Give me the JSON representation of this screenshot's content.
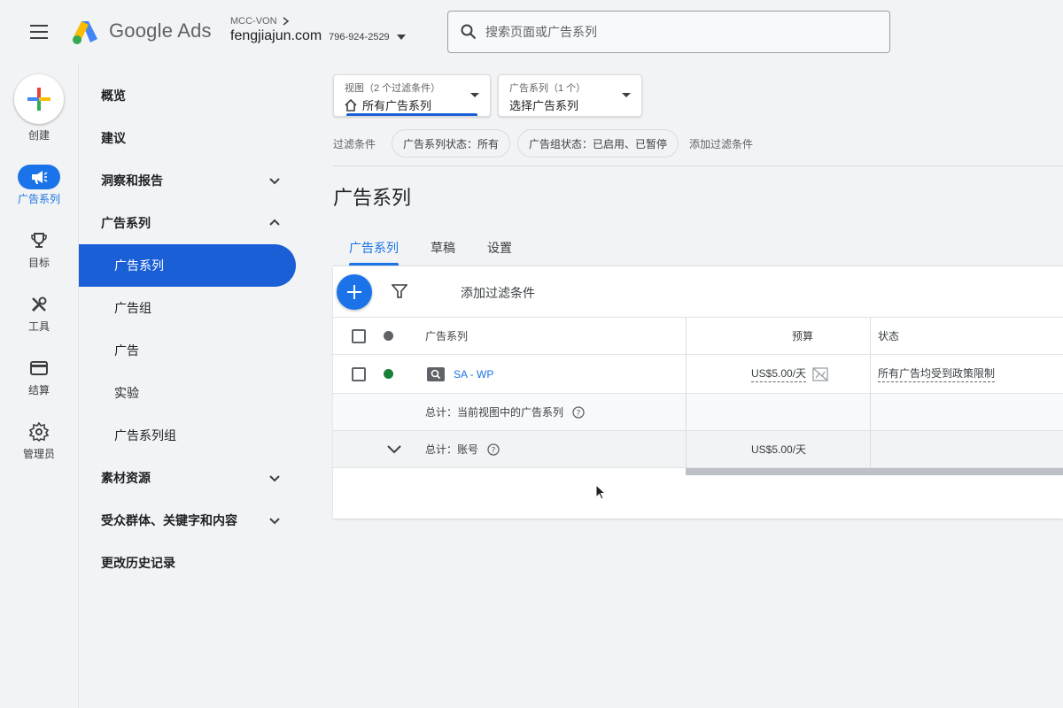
{
  "header": {
    "brand": "Google Ads",
    "account_parent": "MCC-VON",
    "account_domain": "fengjiajun.com",
    "customer_id": "796-924-2529",
    "search_placeholder": "搜索页面或广告系列"
  },
  "rail": {
    "create_label": "创建",
    "items": [
      {
        "label": "广告系列",
        "icon": "megaphone-icon",
        "active": true
      },
      {
        "label": "目标",
        "icon": "trophy-icon"
      },
      {
        "label": "工具",
        "icon": "tools-icon"
      },
      {
        "label": "结算",
        "icon": "credit-card-icon"
      },
      {
        "label": "管理员",
        "icon": "gear-icon"
      }
    ]
  },
  "nav": {
    "items": [
      {
        "label": "概览"
      },
      {
        "label": "建议"
      },
      {
        "label": "洞察和报告",
        "chevron": "down"
      },
      {
        "label": "广告系列",
        "chevron": "up"
      },
      {
        "label": "广告系列",
        "sub": true,
        "active": true
      },
      {
        "label": "广告组",
        "sub": true
      },
      {
        "label": "广告",
        "sub": true
      },
      {
        "label": "实验",
        "sub": true
      },
      {
        "label": "广告系列组",
        "sub": true
      },
      {
        "label": "素材资源",
        "chevron": "down"
      },
      {
        "label": "受众群体、关键字和内容",
        "chevron": "down"
      },
      {
        "label": "更改历史记录"
      }
    ]
  },
  "view_selector": {
    "caption": "视图（2 个过滤条件）",
    "value": "所有广告系列"
  },
  "campaign_selector": {
    "caption": "广告系列（1 个）",
    "value": "选择广告系列"
  },
  "filters": {
    "label": "过滤条件",
    "chips": [
      "广告系列状态：所有",
      "广告组状态：已启用、已暂停"
    ],
    "add_label": "添加过滤条件"
  },
  "page": {
    "title": "广告系列",
    "tabs": [
      {
        "label": "广告系列",
        "active": true
      },
      {
        "label": "草稿"
      },
      {
        "label": "设置"
      }
    ]
  },
  "table": {
    "toolbar_add_filter": "添加过滤条件",
    "columns": {
      "campaign": "广告系列",
      "budget": "预算",
      "status": "状态"
    },
    "rows": [
      {
        "campaign": "SA - WP",
        "budget": "US$5.00/天",
        "status": "所有广告均受到政策限制",
        "status_color": "#188038"
      }
    ],
    "total_view_label": "总计：当前视图中的广告系列",
    "total_account_label": "总计：账号",
    "total_account_budget": "US$5.00/天"
  },
  "colors": {
    "primary": "#1a73e8",
    "nav_active": "#1a5fd6",
    "enabled_dot": "#188038"
  }
}
